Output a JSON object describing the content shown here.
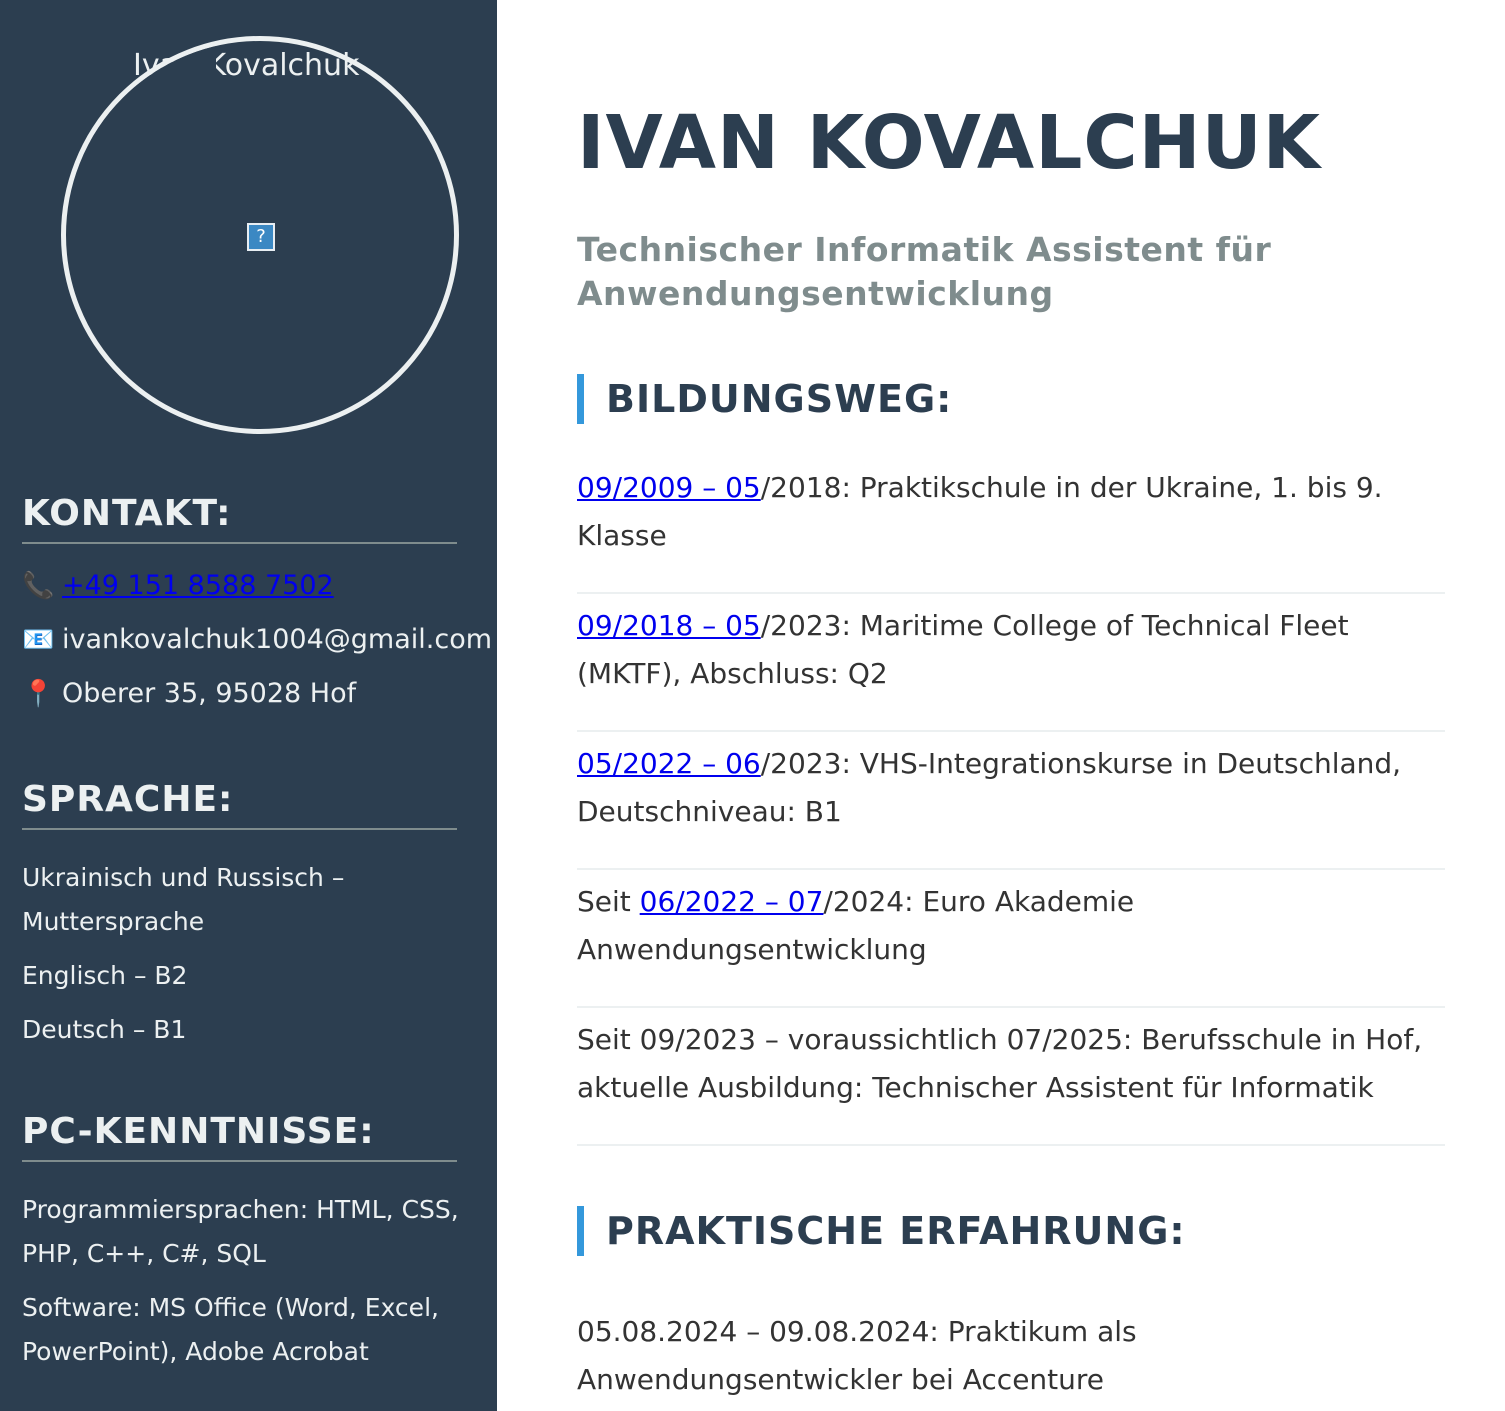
{
  "sidebar": {
    "photo_alt": "Ivan Kovalchuk",
    "photo_icon": "?",
    "contact": {
      "heading": "KONTAKT:",
      "phone_icon": "📞",
      "phone": "+49 151 8588 7502",
      "email_icon": "📧",
      "email": "ivankovalchuk1004@gmail.com",
      "address_icon": "📍",
      "address": "Oberer 35, 95028 Hof"
    },
    "languages": {
      "heading": "SPRACHE:",
      "items": [
        "Ukrainisch und Russisch – Muttersprache",
        "Englisch – B2",
        "Deutsch – B1"
      ]
    },
    "pc": {
      "heading": "PC-KENNTNISSE:",
      "items": [
        "Programmiersprachen: HTML, CSS, PHP, C++, C#, SQL",
        "Software: MS Office (Word, Excel, PowerPoint), Adobe Acrobat"
      ]
    }
  },
  "main": {
    "name": "IVAN KOVALCHUK",
    "subtitle": "Technischer Informatik Assistent für Anwendungsentwicklung",
    "education": {
      "heading": "BILDUNGSWEG:",
      "entries": [
        {
          "prefix": "",
          "link": "09/2009 – 05",
          "rest": "/2018: Praktikschule in der Ukraine, 1. bis 9. Klasse"
        },
        {
          "prefix": "",
          "link": "09/2018 – 05",
          "rest": "/2023: Maritime College of Technical Fleet (MKTF), Abschluss: Q2"
        },
        {
          "prefix": "",
          "link": "05/2022 – 06",
          "rest": "/2023: VHS-Integrationskurse in Deutschland, Deutschniveau: B1"
        },
        {
          "prefix": "Seit ",
          "link": "06/2022 – 07",
          "rest": "/2024: Euro Akademie Anwendungsentwicklung"
        },
        {
          "prefix": "",
          "link": "",
          "rest": "Seit 09/2023 – voraussichtlich 07/2025: Berufsschule in Hof, aktuelle Ausbildung: Technischer Assistent für Informatik"
        }
      ]
    },
    "experience": {
      "heading": "PRAKTISCHE ERFAHRUNG:",
      "entries": [
        "05.08.2024 – 09.08.2024: Praktikum als Anwendungsentwickler bei Accenture"
      ]
    }
  }
}
